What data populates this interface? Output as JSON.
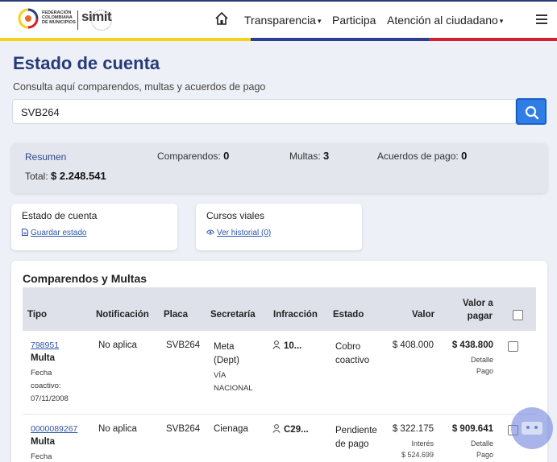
{
  "header": {
    "federation_text": "FEDERACIÓN COLOMBIANA DE MUNICIPIOS",
    "logo_text": "simit",
    "nav": [
      {
        "label": "Transparencia",
        "has_caret": true
      },
      {
        "label": "Participa",
        "has_caret": false
      },
      {
        "label": "Atención al ciudadano",
        "has_caret": true
      }
    ],
    "caret": "▾"
  },
  "page": {
    "title": "Estado de cuenta",
    "subtitle": "Consulta aquí comparendos, multas y acuerdos de pago"
  },
  "search": {
    "value": "SVB264"
  },
  "summary": {
    "label": "Resumen",
    "comparendos_label": "Comparendos:",
    "comparendos_value": "0",
    "multas_label": "Multas:",
    "multas_value": "3",
    "acuerdos_label": "Acuerdos de pago:",
    "acuerdos_value": "0",
    "total_label": "Total:",
    "total_value": "$ 2.248.541"
  },
  "cards": {
    "estado": {
      "title": "Estado de cuenta",
      "link": "Guardar estado"
    },
    "cursos": {
      "title": "Cursos viales",
      "link": "Ver historial (0)"
    }
  },
  "table": {
    "title": "Comparendos y Multas",
    "headers": {
      "tipo": "Tipo",
      "notificacion": "Notificación",
      "placa": "Placa",
      "secretaria": "Secretaría",
      "infraccion": "Infracción",
      "estado": "Estado",
      "valor": "Valor",
      "valor_pagar_1": "Valor a",
      "valor_pagar_2": "pagar"
    },
    "rows": [
      {
        "numero": "798951",
        "tipo": "Multa",
        "fecha_label": "Fecha",
        "fecha_label2": "coactivo:",
        "fecha": "07/11/2008",
        "notificacion": "No aplica",
        "placa": "SVB264",
        "secretaria_1": "Meta",
        "secretaria_2": "(Dept)",
        "secretaria_3": "VÍA",
        "secretaria_4": "NACIONAL",
        "infraccion": "10...",
        "estado_1": "Cobro",
        "estado_2": "coactivo",
        "valor": "$ 408.000",
        "valor_pagar": "$ 438.800",
        "detalle_1": "Detalle",
        "detalle_2": "Pago"
      },
      {
        "numero": "0000089267",
        "tipo": "Multa",
        "fecha_label": "Fecha",
        "notificacion": "No aplica",
        "placa": "SVB264",
        "secretaria_1": "Cienaga",
        "infraccion": "C29...",
        "estado_1": "Pendiente",
        "estado_2": "de pago",
        "valor": "$ 322.175",
        "interes_label": "Interés",
        "interes": "$ 524.699",
        "valor_pagar": "$ 909.641",
        "detalle_1": "Detalle",
        "detalle_2": "Pago"
      }
    ]
  },
  "colors": {
    "brand_blue": "#253a78",
    "search_button": "#2f7ee6",
    "flag_yellow": "#f6d21b",
    "flag_blue": "#2a3f8f",
    "flag_red": "#d2202f"
  }
}
